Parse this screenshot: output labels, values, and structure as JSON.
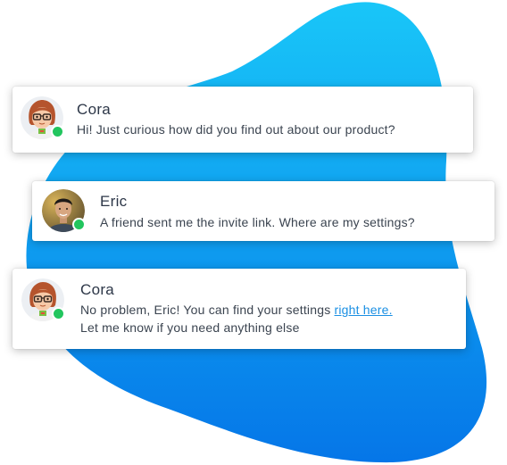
{
  "colors": {
    "background_blob_top": "#19c6f8",
    "background_blob_bottom": "#0576e8",
    "status_online": "#22c55e",
    "link": "#1a8fe3"
  },
  "messages": [
    {
      "author": "Cora",
      "avatar_icon": "cartoon-woman-glasses-avatar",
      "status": "online",
      "text": "Hi! Just curious how did you find out about our product?"
    },
    {
      "author": "Eric",
      "avatar_icon": "man-photo-avatar",
      "status": "online",
      "text": "A friend sent me the invite link. Where are my settings?"
    },
    {
      "author": "Cora",
      "avatar_icon": "cartoon-woman-glasses-avatar",
      "status": "online",
      "text_before_link": "No problem, Eric! You can find your settings ",
      "link_text": "right here.",
      "text_after_link": "Let me know if you need anything else"
    }
  ]
}
